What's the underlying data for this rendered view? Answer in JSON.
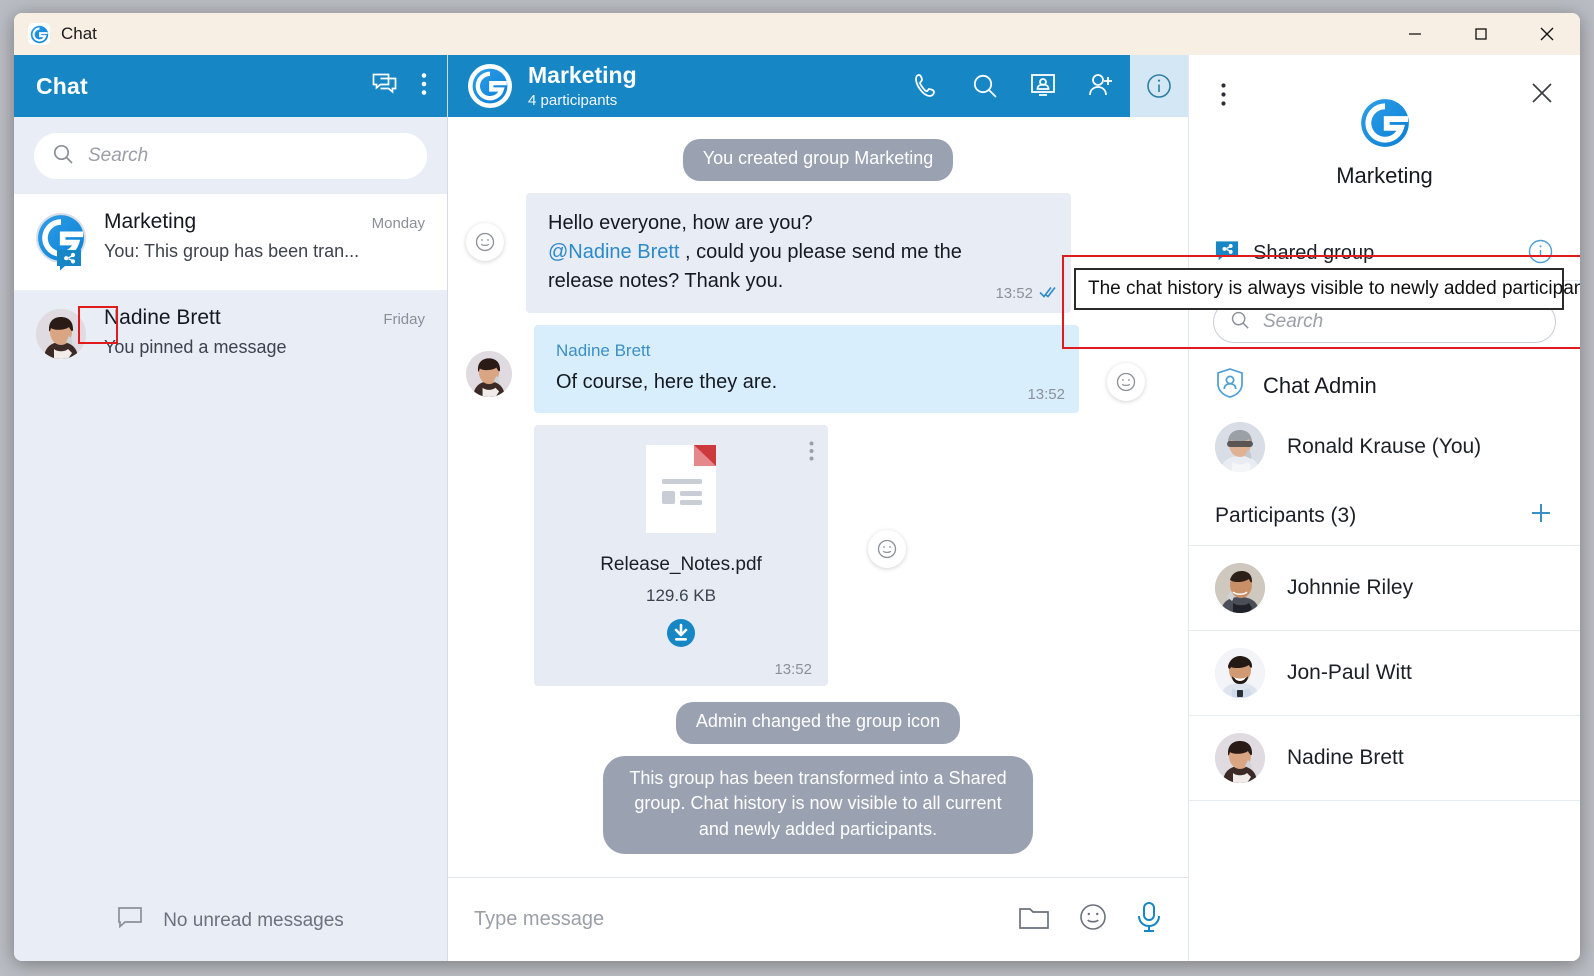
{
  "window": {
    "title": "Chat",
    "logo_icon": "app-logo-icon",
    "controls": {
      "minimize": "minimize-icon",
      "maximize": "maximize-icon",
      "close": "close-icon"
    }
  },
  "sidebar": {
    "header": {
      "title": "Chat",
      "new_chat_icon": "new-chat-icon",
      "menu_icon": "kebab-menu-icon"
    },
    "search": {
      "placeholder": "Search",
      "icon": "search-icon"
    },
    "chats": [
      {
        "name": "Marketing",
        "time": "Monday",
        "preview": "You: This group has been tran...",
        "selected": true,
        "badge": "shared-group-badge-icon"
      },
      {
        "name": "Nadine Brett",
        "time": "Friday",
        "preview": "You pinned a message",
        "selected": false,
        "badge": ""
      }
    ],
    "footer": {
      "label": "No unread messages",
      "icon": "message-bubble-icon"
    }
  },
  "chat": {
    "header": {
      "title": "Marketing",
      "subtitle": "4 participants",
      "avatar_icon": "group-logo-icon",
      "actions": [
        {
          "name": "call-icon",
          "label": "Call",
          "active": false
        },
        {
          "name": "search-icon",
          "label": "Search",
          "active": false
        },
        {
          "name": "conference-icon",
          "label": "Conference",
          "active": false
        },
        {
          "name": "add-participant-icon",
          "label": "Add participant",
          "active": false
        },
        {
          "name": "info-icon",
          "label": "Info",
          "active": true
        }
      ]
    },
    "messages": [
      {
        "type": "system",
        "text": "You created group Marketing"
      },
      {
        "type": "outgoing",
        "lines": [
          "Hello everyone, how are you?"
        ],
        "mention": "@Nadine Brett",
        "mention_tail": " , could you please send me the",
        "line3": "release notes? Thank you.",
        "time": "13:52",
        "status_icon": "read-check-icon",
        "reaction_icon": "emoji-reaction-icon"
      },
      {
        "type": "incoming",
        "sender": "Nadine Brett",
        "text": "Of course, here they are.",
        "time": "13:52",
        "reaction_icon": "emoji-reaction-icon"
      },
      {
        "type": "file",
        "file_type": "PDF",
        "filename": "Release_Notes.pdf",
        "filesize": "129.6 KB",
        "time": "13:52",
        "download_icon": "download-icon",
        "menu_icon": "kebab-menu-icon",
        "reaction_icon": "emoji-reaction-icon"
      },
      {
        "type": "system",
        "text": "Admin changed the group icon"
      },
      {
        "type": "system",
        "text": "This group has been transformed into a Shared group. Chat history is now visible to all current and newly added participants."
      }
    ],
    "composer": {
      "placeholder": "Type message",
      "icons": [
        {
          "name": "attach-folder-icon"
        },
        {
          "name": "emoji-icon"
        },
        {
          "name": "microphone-icon"
        }
      ]
    }
  },
  "right_panel": {
    "menu_icon": "kebab-menu-icon",
    "close_icon": "close-icon",
    "logo_icon": "group-logo-icon",
    "group_name": "Marketing",
    "shared_group": {
      "label": "Shared group",
      "badge_icon": "shared-group-badge-icon",
      "info_icon": "info-circle-icon"
    },
    "search": {
      "placeholder": "Search",
      "icon": "search-icon"
    },
    "admin": {
      "label": "Chat Admin",
      "icon": "shield-person-icon"
    },
    "owner": {
      "name": "Ronald Krause (You)"
    },
    "participants_header": {
      "label": "Participants (3)",
      "add_icon": "plus-icon"
    },
    "participants": [
      {
        "name": "Johnnie Riley"
      },
      {
        "name": "Jon-Paul Witt"
      },
      {
        "name": "Nadine Brett"
      }
    ]
  },
  "tooltip": {
    "text": "The chat history is always visible to newly added participants"
  },
  "colors": {
    "brand_blue": "#1686c5",
    "titlebar_cream": "#f7eee4",
    "sidebar_bg": "#e9edf6",
    "bubble_outgoing": "#e8ecf5",
    "bubble_incoming": "#d9eefc",
    "system_pill": "#9aa1b1",
    "annotation_red": "#e01b1b",
    "pdf_red": "#cd3a3e"
  }
}
